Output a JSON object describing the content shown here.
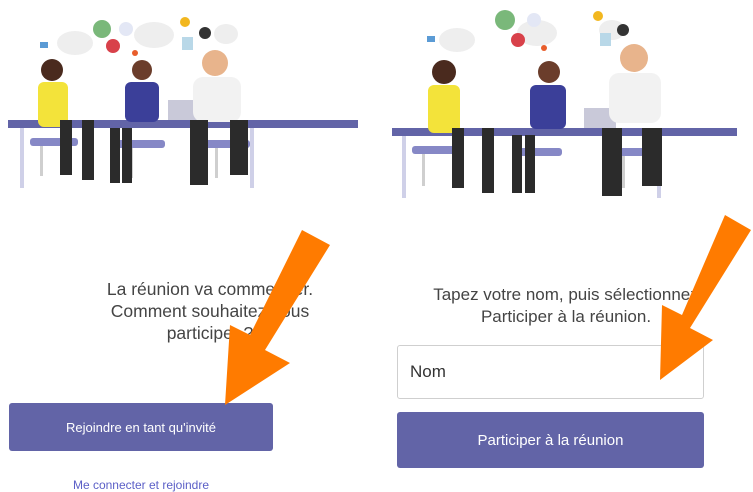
{
  "left": {
    "prompt_lines": [
      "La réunion va commencer.",
      "Comment souhaitez-vous",
      "participer ?"
    ],
    "join_guest_label": "Rejoindre en tant qu'invité",
    "sign_in_link": "Me connecter et rejoindre"
  },
  "right": {
    "prompt_lines": [
      "Tapez votre nom, puis sélectionnez",
      "Participer à la réunion."
    ],
    "name_placeholder": "Nom",
    "join_button_label": "Participer à la réunion"
  },
  "colors": {
    "brand": "#6264a7",
    "annotation_arrow": "#ff7b00"
  },
  "icons": [
    "people-meeting-illustration",
    "annotation-arrow"
  ]
}
